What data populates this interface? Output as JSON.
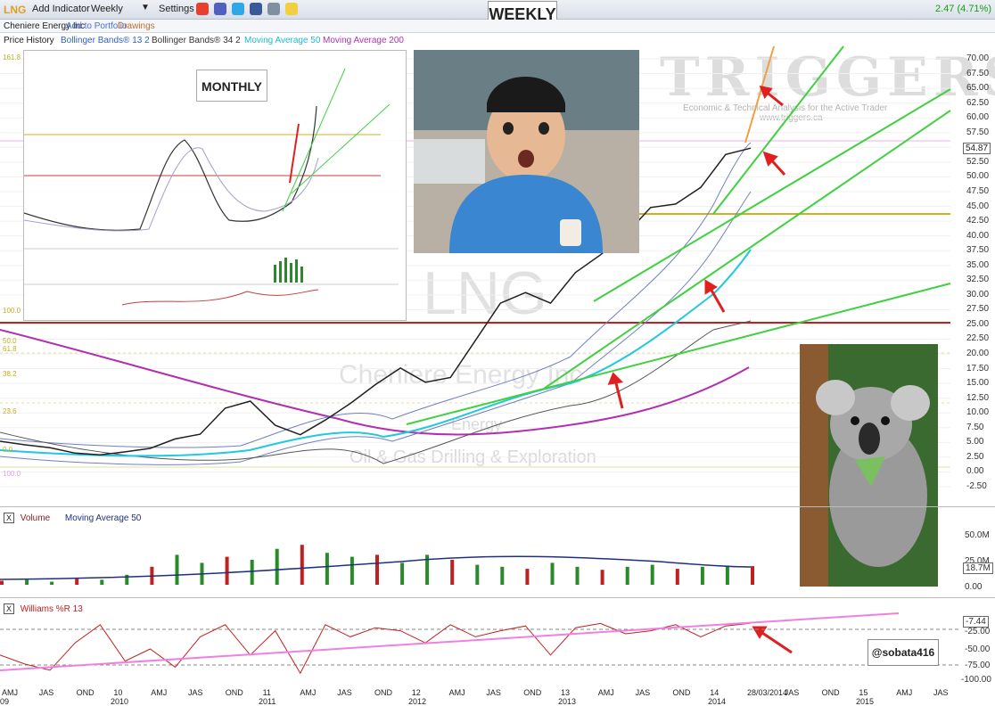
{
  "toolbar": {
    "symbol": "LNG",
    "add_indicator": "Add Indicator",
    "period": "Weekly",
    "settings": "Settings",
    "change": "2.47 (4.71%)",
    "icons": [
      "alarm-icon",
      "book-icon",
      "twitter-icon",
      "facebook-icon",
      "print-icon",
      "note-icon"
    ]
  },
  "subbar": {
    "company": "Cheniere Energy Inc",
    "add_to_portfolio": "Add to Portfolio",
    "drawings": "Drawings"
  },
  "indicators": {
    "price_history": "Price History",
    "bb1": "Bollinger Bands® 13 2",
    "bb2": "Bollinger Bands® 34 2",
    "ma50": "Moving Average 50",
    "ma200": "Moving Average 200"
  },
  "weekly_label": "WEEKLY",
  "monthly_label": "MONTHLY",
  "watermark": {
    "brand": "TRIGGERS",
    "tagline": "Economic & Technical Analysis for the Active Trader",
    "url": "www.triggers.ca",
    "symbol": "LNG",
    "name": "Cheniere Energy Inc",
    "sector": "Energy",
    "industry": "Oil & Gas Drilling & Exploration"
  },
  "handle": "@sobata416",
  "last_price_label": "54.87",
  "fib_labels": [
    "161.8",
    "100.0",
    "61.8",
    "50.0",
    "38.2",
    "23.6",
    "0.0",
    "100.0"
  ],
  "volume_panel": {
    "title": "Volume",
    "ma": "Moving Average 50",
    "axis": [
      "50.0M",
      "25.0M",
      "0.00"
    ],
    "last": "18.7M"
  },
  "wr_panel": {
    "title": "Williams %R 13",
    "axis": [
      "-25.00",
      "-50.00",
      "-75.00",
      "-100.00"
    ],
    "last": "-7.44"
  },
  "x_axis": {
    "ticks": [
      "AMJ",
      "JAS",
      "OND",
      "10",
      "AMJ",
      "JAS",
      "OND",
      "11",
      "AMJ",
      "JAS",
      "OND",
      "12",
      "AMJ",
      "JAS",
      "OND",
      "13",
      "AMJ",
      "JAS",
      "OND",
      "14",
      "28/03/2014",
      "JAS",
      "OND",
      "15",
      "AMJ",
      "JAS"
    ],
    "years": [
      "09",
      "2010",
      "2011",
      "2012",
      "2013",
      "2014",
      "2015"
    ]
  },
  "chart_data": {
    "type": "line",
    "title": "LNG",
    "ylabel": "",
    "ylim": [
      -2.5,
      70
    ],
    "y_ticks": [
      "70.00",
      "67.50",
      "65.00",
      "62.50",
      "60.00",
      "57.50",
      "55.00",
      "52.50",
      "50.00",
      "47.50",
      "45.00",
      "42.50",
      "40.00",
      "37.50",
      "35.00",
      "32.50",
      "30.00",
      "27.50",
      "25.00",
      "22.50",
      "20.00",
      "17.50",
      "15.00",
      "12.50",
      "10.00",
      "7.50",
      "5.00",
      "2.50",
      "0.00",
      "-2.50"
    ],
    "series": [
      {
        "values": [
          5.2,
          4.6,
          4.1,
          3.2,
          2.9,
          3.4,
          4.0,
          5.6,
          6.4,
          10.8,
          12.0,
          7.9,
          6.3,
          8.8,
          11.6,
          14.8,
          17.6,
          15.2,
          16.0,
          22.3,
          28.6,
          30.4,
          28.6,
          33.8,
          36.8,
          40.2,
          44.8,
          45.4,
          48.2,
          53.8,
          54.87
        ]
      }
    ],
    "williams_r": [
      -60,
      -75,
      -85,
      -40,
      -10,
      -70,
      -50,
      -80,
      -30,
      -10,
      -60,
      -20,
      -90,
      -10,
      -30,
      -15,
      -20,
      -40,
      -10,
      -30,
      -20,
      -12,
      -60,
      -15,
      -8,
      -25,
      -20,
      -10,
      -30,
      -12,
      -7.44
    ],
    "volume_m": [
      4,
      5,
      3,
      6,
      5,
      10,
      18,
      30,
      22,
      28,
      25,
      36,
      40,
      32,
      28,
      30,
      22,
      30,
      25,
      20,
      18,
      16,
      22,
      18,
      15,
      18,
      20,
      16,
      18,
      19,
      18.7
    ]
  }
}
